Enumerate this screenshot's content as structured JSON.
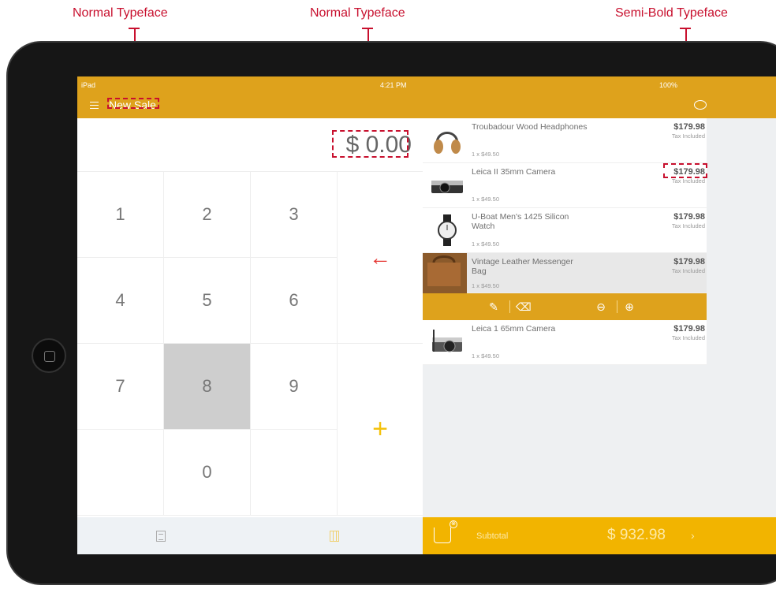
{
  "annotations": {
    "title_label": "Normal Typeface",
    "amount_label": "Normal Typeface",
    "price_label": "Semi-Bold Typeface"
  },
  "statusbar": {
    "carrier": "iPad",
    "time": "4:21 PM",
    "battery": "100%"
  },
  "nav": {
    "title": "New Sale"
  },
  "amount": "$ 0.00",
  "keypad": [
    "1",
    "2",
    "3",
    "4",
    "5",
    "6",
    "7",
    "8",
    "9",
    "0"
  ],
  "keypad_selected": "8",
  "keypad_back": "←",
  "keypad_add": "+",
  "cart": {
    "items": [
      {
        "name": "Troubadour Wood Headphones",
        "qty": "1 x $49.50",
        "price": "$179.98",
        "tax": "Tax Included"
      },
      {
        "name": "Leica II 35mm Camera",
        "qty": "1 x $49.50",
        "price": "$179.98",
        "tax": "Tax Included"
      },
      {
        "name": "U-Boat Men's 1425 Silicon Watch",
        "qty": "1 x $49.50",
        "price": "$179.98",
        "tax": "Tax Included"
      },
      {
        "name": "Vintage Leather Messenger Bag",
        "qty": "1 x $49.50",
        "price": "$179.98",
        "tax": "Tax Included"
      },
      {
        "name": "Leica 1 65mm Camera",
        "qty": "1 x $49.50",
        "price": "$179.98",
        "tax": "Tax Included"
      }
    ],
    "selected_index": 3
  },
  "checkout": {
    "subtotal_label": "Subtotal",
    "subtotal_value": "$ 932.98",
    "badge": "⊗",
    "chevron": "›"
  },
  "colors": {
    "brand": "#dea21c",
    "checkout": "#f2b400",
    "annotation": "#c8102e",
    "back_arrow": "#e53935"
  }
}
